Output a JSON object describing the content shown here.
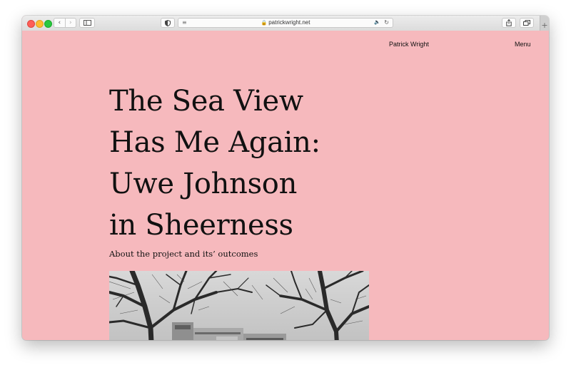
{
  "browser": {
    "url": "patrickwright.net",
    "back_icon": "chevron-left-icon",
    "forward_icon": "chevron-right-icon",
    "new_tab_label": "+"
  },
  "site": {
    "name": "Patrick Wright",
    "menu_label": "Menu"
  },
  "article": {
    "title_lines": [
      "The Sea View",
      "Has Me Again:",
      "Uwe Johnson",
      "in Sheerness"
    ],
    "subtitle": "About the project and its’ outcomes"
  },
  "colors": {
    "page_background": "#f6b9bd",
    "text": "#111111"
  }
}
